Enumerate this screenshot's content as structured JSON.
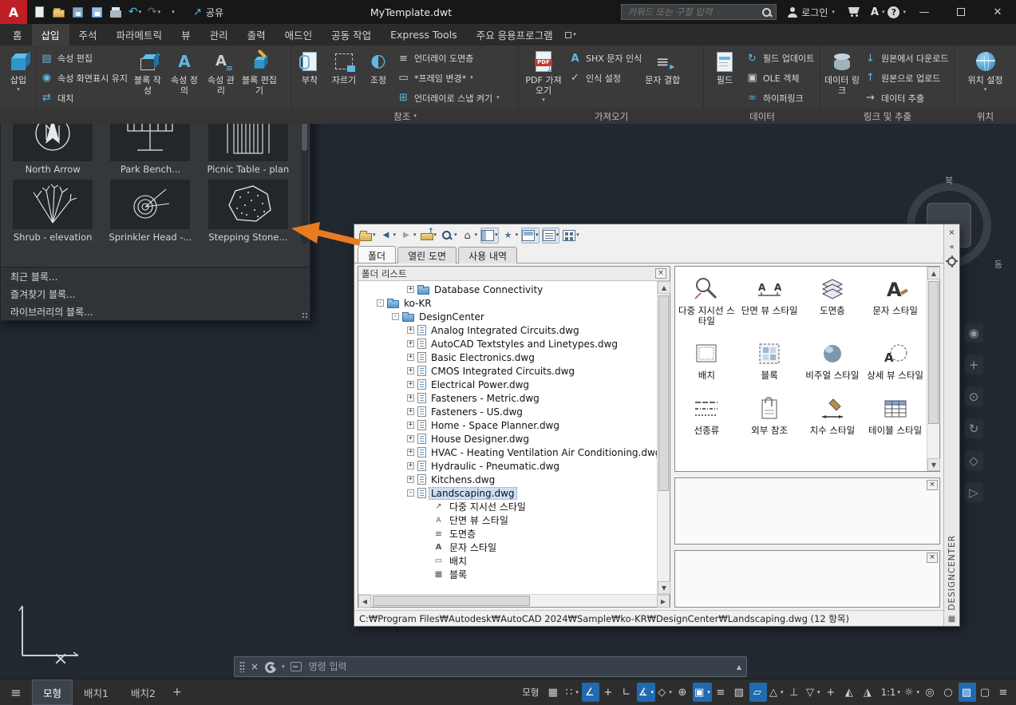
{
  "titlebar": {
    "app_letter": "A",
    "doc_title": "MyTemplate.dwt",
    "share_label": "공유",
    "search_placeholder": "키워드 또는 구절 입력",
    "signin_label": "로그인"
  },
  "ribbon": {
    "tabs": [
      {
        "label": "홈"
      },
      {
        "label": "삽입",
        "active": true
      },
      {
        "label": "주석"
      },
      {
        "label": "파라메트릭"
      },
      {
        "label": "뷰"
      },
      {
        "label": "관리"
      },
      {
        "label": "출력"
      },
      {
        "label": "애드인"
      },
      {
        "label": "공동 작업"
      },
      {
        "label": "Express Tools"
      },
      {
        "label": "주요 응용프로그램"
      }
    ],
    "blocks_panel": {
      "insert": "삽입"
    },
    "blockdef_panel": {
      "attr_edit": "속성 편집",
      "keep_display": "속성 화면표시 유지",
      "replace": "대치",
      "block_create": "블록 작성",
      "attr_define": "속성 정의",
      "attr_manage": "속성 관리",
      "block_editor": "블록 편집기"
    },
    "reference_panel": {
      "attach": "부착",
      "clip": "자르기",
      "adjust": "조정",
      "underlay_layers": "언더레이 도면층",
      "frame_change": "*프레임 변경*",
      "snap_to_underlay": "언더레이로 스냅 켜기",
      "label": "참조"
    },
    "import_panel": {
      "pdf_import": "PDF 가져오기",
      "shx_recognize": "SHX 문자 인식",
      "recognition_settings": "인식 설정",
      "combine_text": "문자 결합",
      "label": "가져오기"
    },
    "data_panel": {
      "field": "필드",
      "field_update": "필드 업데이트",
      "ole_object": "OLE 객체",
      "hyperlink": "하이퍼링크",
      "label": "데이터"
    },
    "link_panel": {
      "data_link": "데이터 링크",
      "download": "원본에서 다운로드",
      "upload": "원본으로 업로드",
      "extract": "데이터 추출",
      "label": "링크 및 추출"
    },
    "location_panel": {
      "set_location": "위치 설정",
      "label": "위치"
    }
  },
  "gallery": {
    "blocks": [
      {
        "name": "North Arrow"
      },
      {
        "name": "Park Bench..."
      },
      {
        "name": "Picnic Table - plan"
      },
      {
        "name": "Shrub - elevation"
      },
      {
        "name": "Sprinkler Head -..."
      },
      {
        "name": "Stepping Stone..."
      }
    ],
    "footer": [
      {
        "label": "최근 블록...",
        "name": "recent-blocks-item"
      },
      {
        "label": "즐겨찾기 블록...",
        "name": "favorite-blocks-item"
      },
      {
        "label": "라이브러리의 블록...",
        "name": "library-blocks-item"
      }
    ]
  },
  "designcenter": {
    "toolbar": [
      {
        "name": "load-icon",
        "icon": "open"
      },
      {
        "name": "back-icon",
        "icon": "back",
        "caret": true
      },
      {
        "name": "forward-icon",
        "icon": "forward",
        "caret": true
      },
      {
        "name": "up-icon",
        "icon": "up"
      },
      {
        "name": "search-icon",
        "icon": "search"
      },
      {
        "name": "home-icon",
        "icon": "home"
      },
      {
        "name": "tree-view-toggle-icon",
        "icon": "tree",
        "pressed": true
      },
      {
        "name": "favorites-icon",
        "icon": "star"
      },
      {
        "name": "preview-toggle-icon",
        "icon": "preview",
        "pressed": true
      },
      {
        "name": "description-toggle-icon",
        "icon": "desc",
        "pressed": true
      },
      {
        "name": "views-icon",
        "icon": "views",
        "caret": true
      }
    ],
    "tabs": [
      {
        "label": "폴더",
        "active": true
      },
      {
        "label": "열린 도면"
      },
      {
        "label": "사용 내역"
      }
    ],
    "tree_title": "폴더 리스트",
    "tree": [
      {
        "label": "Database Connectivity",
        "depth": 3,
        "expand": "+",
        "icon": "folder"
      },
      {
        "label": "ko-KR",
        "depth": 1,
        "expand": "-",
        "icon": "folder"
      },
      {
        "label": "DesignCenter",
        "depth": 2,
        "expand": "-",
        "icon": "folder"
      },
      {
        "label": "Analog Integrated Circuits.dwg",
        "depth": 3,
        "expand": "+",
        "icon": "dwg"
      },
      {
        "label": "AutoCAD Textstyles and Linetypes.dwg",
        "depth": 3,
        "expand": "+",
        "icon": "dwg"
      },
      {
        "label": "Basic Electronics.dwg",
        "depth": 3,
        "expand": "+",
        "icon": "dwg"
      },
      {
        "label": "CMOS Integrated Circuits.dwg",
        "depth": 3,
        "expand": "+",
        "icon": "dwg"
      },
      {
        "label": "Electrical Power.dwg",
        "depth": 3,
        "expand": "+",
        "icon": "dwg"
      },
      {
        "label": "Fasteners - Metric.dwg",
        "depth": 3,
        "expand": "+",
        "icon": "dwg"
      },
      {
        "label": "Fasteners - US.dwg",
        "depth": 3,
        "expand": "+",
        "icon": "dwg"
      },
      {
        "label": "Home - Space Planner.dwg",
        "depth": 3,
        "expand": "+",
        "icon": "dwg"
      },
      {
        "label": "House Designer.dwg",
        "depth": 3,
        "expand": "+",
        "icon": "dwg"
      },
      {
        "label": "HVAC - Heating Ventilation Air Conditioning.dwg",
        "depth": 3,
        "expand": "+",
        "icon": "dwg"
      },
      {
        "label": "Hydraulic - Pneumatic.dwg",
        "depth": 3,
        "expand": "+",
        "icon": "dwg"
      },
      {
        "label": "Kitchens.dwg",
        "depth": 3,
        "expand": "+",
        "icon": "dwg"
      },
      {
        "label": "Landscaping.dwg",
        "depth": 3,
        "expand": "-",
        "icon": "dwg",
        "selected": true
      },
      {
        "label": "다중 지시선 스타일",
        "depth": 4,
        "expand": "",
        "icon": "mleader"
      },
      {
        "label": "단면 뷰 스타일",
        "depth": 4,
        "expand": "",
        "icon": "section"
      },
      {
        "label": "도면층",
        "depth": 4,
        "expand": "",
        "icon": "layer"
      },
      {
        "label": "문자 스타일",
        "depth": 4,
        "expand": "",
        "icon": "textstyle"
      },
      {
        "label": "배치",
        "depth": 4,
        "expand": "",
        "icon": "layout"
      },
      {
        "label": "블록",
        "depth": 4,
        "expand": "",
        "icon": "block"
      }
    ],
    "content_items": [
      {
        "label": "다중 지시선 스타일",
        "icon": "mleader-style-icon"
      },
      {
        "label": "단면 뷰 스타일",
        "icon": "section-view-style-icon"
      },
      {
        "label": "도면층",
        "icon": "layer-icon"
      },
      {
        "label": "문자 스타일",
        "icon": "text-style-icon"
      },
      {
        "label": "배치",
        "icon": "layout-icon"
      },
      {
        "label": "블록",
        "icon": "block-icon"
      },
      {
        "label": "비주얼 스타일",
        "icon": "visual-style-icon"
      },
      {
        "label": "상세 뷰 스타일",
        "icon": "detail-view-style-icon"
      },
      {
        "label": "선종류",
        "icon": "linetype-icon"
      },
      {
        "label": "외부 참조",
        "icon": "xref-icon"
      },
      {
        "label": "치수 스타일",
        "icon": "dimension-style-icon"
      },
      {
        "label": "테이블 스타일",
        "icon": "table-style-icon"
      }
    ],
    "status_text": "C:₩Program Files₩Autodesk₩AutoCAD 2024₩Sample₩ko-KR₩DesignCenter₩Landscaping.dwg (12 항목)",
    "side_title": "DESIGNCENTER"
  },
  "viewcube": {
    "north": "북",
    "east": "동"
  },
  "navbar": [
    {
      "name": "steering-wheel-icon",
      "glyph": "◉"
    },
    {
      "name": "pan-icon",
      "glyph": "+"
    },
    {
      "name": "zoom-icon",
      "glyph": "⊙"
    },
    {
      "name": "orbit-icon",
      "glyph": "↻"
    },
    {
      "name": "showmotion-icon",
      "glyph": "◇"
    },
    {
      "name": "navbar-more-icon",
      "glyph": "▷"
    }
  ],
  "commandline": {
    "placeholder": "명령 입력"
  },
  "statusbar": {
    "model_label": "모형",
    "layout_tabs": [
      {
        "label": "모형",
        "active": true
      },
      {
        "label": "배치1"
      },
      {
        "label": "배치2"
      }
    ],
    "icons": [
      {
        "name": "grid-icon",
        "icon": "grid"
      },
      {
        "name": "snap-icon",
        "icon": "snap",
        "caret": true
      },
      {
        "name": "infer-constraints-icon",
        "icon": "infer",
        "active": true
      },
      {
        "name": "dynamic-input-icon",
        "icon": "dyninput"
      },
      {
        "name": "ortho-icon",
        "icon": "ortho"
      },
      {
        "name": "polar-tracking-icon",
        "icon": "polar",
        "active": true,
        "caret": true
      },
      {
        "name": "isodraft-icon",
        "icon": "isodraft",
        "caret": true
      },
      {
        "name": "osnap-tracking-icon",
        "icon": "otrack"
      },
      {
        "name": "osnap-icon",
        "icon": "osnap",
        "active": true,
        "caret": true
      },
      {
        "name": "lineweight-icon",
        "icon": "lineweight"
      },
      {
        "name": "transparency-icon",
        "icon": "transparency"
      },
      {
        "name": "selection-cycling-icon",
        "icon": "cycling",
        "active": true
      },
      {
        "name": "3d-osnap-icon",
        "icon": "threed",
        "caret": true
      },
      {
        "name": "dynamic-ucs-icon",
        "icon": "ducs"
      },
      {
        "name": "selection-filter-icon",
        "icon": "filter",
        "caret": true
      },
      {
        "name": "gizmo-icon",
        "icon": "gizmo"
      },
      {
        "name": "annotation-visibility-icon",
        "icon": "annovis"
      },
      {
        "name": "autoscale-icon",
        "icon": "autoscale"
      },
      {
        "name": "annotation-scale-button",
        "icon": "scale",
        "label": "1:1",
        "caret": true
      },
      {
        "name": "workspace-switching-icon",
        "icon": "gear",
        "caret": true
      },
      {
        "name": "annotation-monitor-icon",
        "icon": "monitor"
      },
      {
        "name": "isolate-objects-icon",
        "icon": "isolate"
      },
      {
        "name": "graphics-performance-icon",
        "icon": "graphics",
        "active": true
      },
      {
        "name": "clean-screen-icon",
        "icon": "clean"
      },
      {
        "name": "customization-icon",
        "icon": "customize"
      }
    ]
  }
}
